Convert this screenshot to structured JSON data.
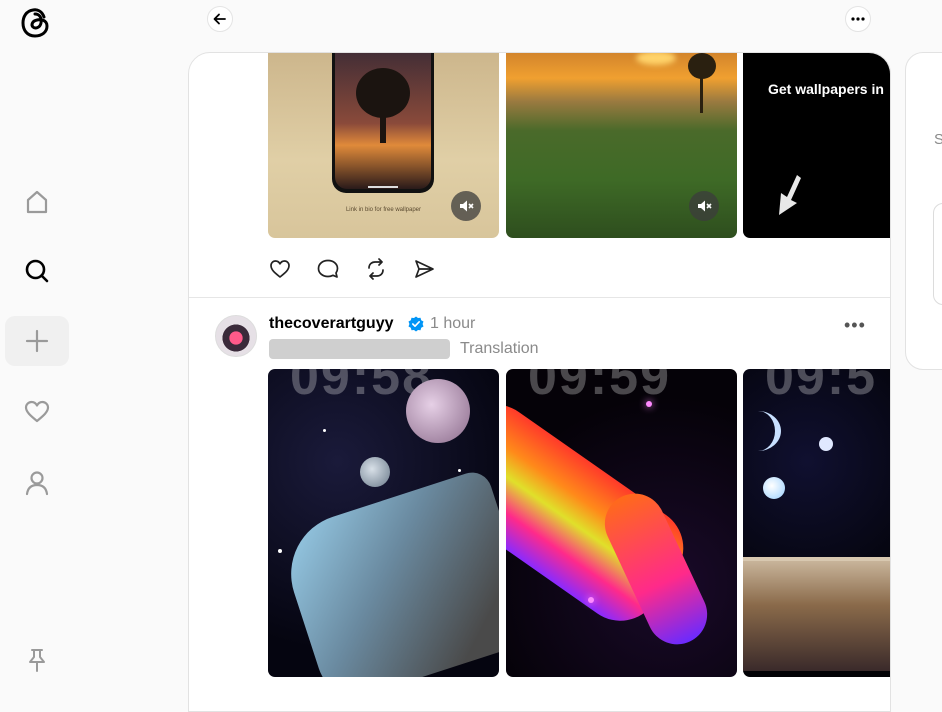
{
  "sidebar": {
    "logo_icon": "threads-logo-icon",
    "items": [
      {
        "name": "home",
        "icon": "home-icon"
      },
      {
        "name": "search",
        "icon": "search-icon"
      },
      {
        "name": "create",
        "icon": "plus-icon"
      },
      {
        "name": "activity",
        "icon": "heart-icon"
      },
      {
        "name": "profile",
        "icon": "user-icon"
      },
      {
        "name": "pin",
        "icon": "pin-icon"
      }
    ]
  },
  "topbar": {
    "back_icon": "arrow-left-icon",
    "more_icon": "ellipsis-icon"
  },
  "post1": {
    "media_caption": "Link in bio for free wallpaper",
    "media3_text": "Get wallpapers in",
    "mute_icon": "muted-speaker-icon",
    "actions": [
      "heart-icon",
      "comment-icon",
      "repost-icon",
      "share-icon"
    ]
  },
  "post2": {
    "username": "thecoverartguyy",
    "time": "1 hour",
    "translation_label": "Translation",
    "more_label": "•••",
    "media_overlay_text": [
      "09:58",
      "09:59",
      "09:5"
    ]
  },
  "right_panel": {
    "partial_text": "S"
  },
  "colors": {
    "verified": "#0095f6",
    "muted_text": "#8a8a8a",
    "background": "#fafafa"
  }
}
